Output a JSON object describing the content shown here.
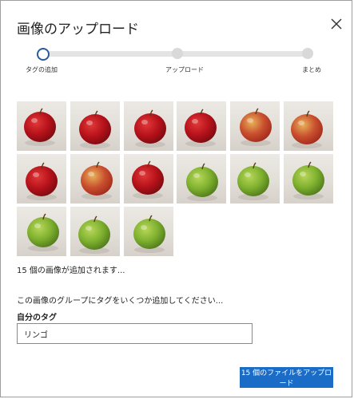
{
  "dialog": {
    "title": "画像のアップロード",
    "close_icon": "close-icon"
  },
  "stepper": {
    "steps": [
      "タグの追加",
      "アップロード",
      "まとめ"
    ],
    "current_step": 1
  },
  "thumbnails": {
    "count": 15,
    "apples": [
      {
        "variety": "red"
      },
      {
        "variety": "red"
      },
      {
        "variety": "red"
      },
      {
        "variety": "red"
      },
      {
        "variety": "red-yellow"
      },
      {
        "variety": "red-yellow"
      },
      {
        "variety": "red"
      },
      {
        "variety": "red-yellow"
      },
      {
        "variety": "red"
      },
      {
        "variety": "green"
      },
      {
        "variety": "green"
      },
      {
        "variety": "green"
      },
      {
        "variety": "green"
      },
      {
        "variety": "green"
      },
      {
        "variety": "green"
      }
    ],
    "colors": {
      "red": "#b8121b",
      "red-yellow": "#c9502e",
      "green": "#7fb12f"
    }
  },
  "status": {
    "count_text": "15 個の画像が追加されます..."
  },
  "tagging": {
    "prompt": "この画像のグループにタグをいくつか追加してください...",
    "label": "自分のタグ",
    "value": "リンゴ"
  },
  "footer": {
    "upload_label": "15 個のファイルをアップロード"
  },
  "theme": {
    "accent": "#1a6cc7",
    "step_active": "#2b5a9b"
  }
}
